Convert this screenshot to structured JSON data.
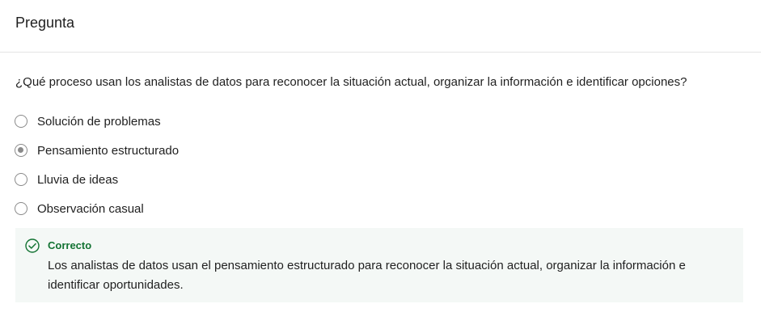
{
  "header": {
    "title": "Pregunta"
  },
  "question": {
    "text": "¿Qué proceso usan los analistas de datos para reconocer la situación actual, organizar la información e identificar opciones?"
  },
  "options": [
    {
      "label": "Solución de problemas",
      "selected": false
    },
    {
      "label": "Pensamiento estructurado",
      "selected": true
    },
    {
      "label": "Lluvia de ideas",
      "selected": false
    },
    {
      "label": "Observación casual",
      "selected": false
    }
  ],
  "feedback": {
    "status": "Correcto",
    "message": "Los analistas de datos usan el pensamiento estructurado para reconocer la situación actual, organizar la información e identificar oportunidades.",
    "icon": "check-circle-icon",
    "accent_color": "#137333",
    "background_color": "#f4f8f6"
  }
}
